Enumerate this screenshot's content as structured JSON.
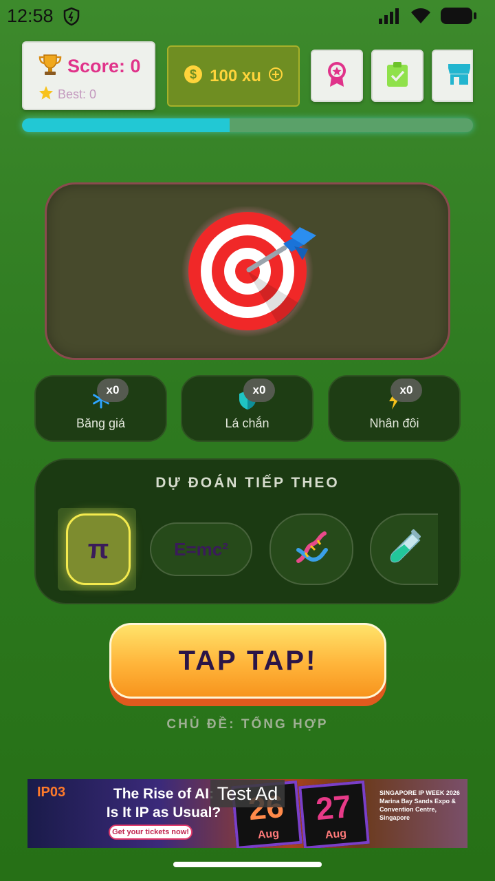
{
  "status_bar": {
    "time": "12:58"
  },
  "header": {
    "score_label": "Score: 0",
    "best_label": "Best: 0",
    "coins_label": "100 xu",
    "progress_fraction": 0.46
  },
  "powerups": [
    {
      "label": "Băng giá",
      "count": "x0",
      "icon": "snowflake-icon"
    },
    {
      "label": "Lá chắn",
      "count": "x0",
      "icon": "shield-icon"
    },
    {
      "label": "Nhân đôi",
      "count": "x0",
      "icon": "lightning-icon"
    }
  ],
  "predict": {
    "title": "DỰ ĐOÁN TIẾP THEO",
    "items": [
      {
        "text": "π",
        "active": true
      },
      {
        "text": "E=mc²",
        "active": false
      },
      {
        "text": "",
        "icon": "dna-icon",
        "active": false
      },
      {
        "text": "",
        "icon": "test-tube-icon",
        "active": false
      }
    ]
  },
  "tap_button": {
    "label": "TAP TAP!"
  },
  "topic": {
    "label": "CHỦ ĐỀ: TỔNG HỢP"
  },
  "ad": {
    "badge": "Test Ad",
    "logo": "IP03",
    "headline_1": "The Rise of AI:",
    "headline_2": "Is It IP as Usual?",
    "cta": "Get your tickets now!",
    "date_1_num": "26",
    "date_1_mon": "Aug",
    "date_2_num": "27",
    "date_2_mon": "Aug",
    "info": "SINGAPORE IP WEEK 2026 Marina Bay Sands Expo & Convention Centre, Singapore"
  },
  "colors": {
    "score_pink": "#e0338a",
    "coin_gold": "#ffd43b",
    "progress_cyan": "#22c8d4",
    "tap_orange": "#f7941d"
  }
}
